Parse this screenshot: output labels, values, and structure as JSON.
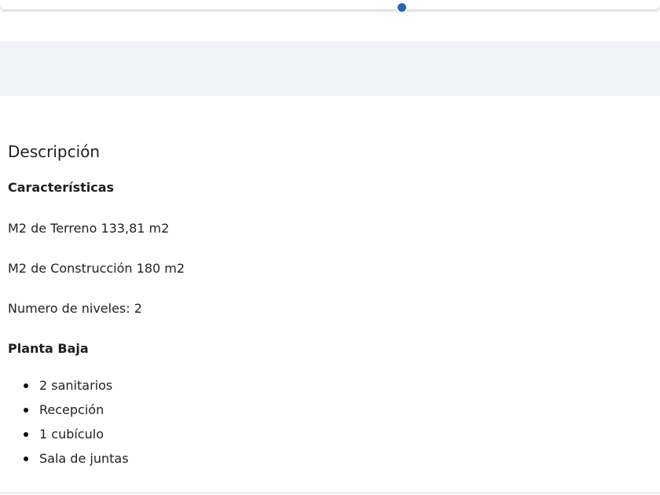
{
  "description": {
    "title": "Descripción",
    "characteristics_heading": "Características",
    "land_area": "M2 de Terreno 133,81 m2",
    "construction_area": "M2 de Construcción 180 m2",
    "levels": "Numero de niveles: 2",
    "ground_floor_heading": "Planta Baja",
    "ground_floor_items": [
      "2 sanitarios",
      "Recepción",
      "1 cubículo",
      "Sala de juntas"
    ]
  },
  "carousel": {
    "active_dot_color": "#2a66ad"
  }
}
